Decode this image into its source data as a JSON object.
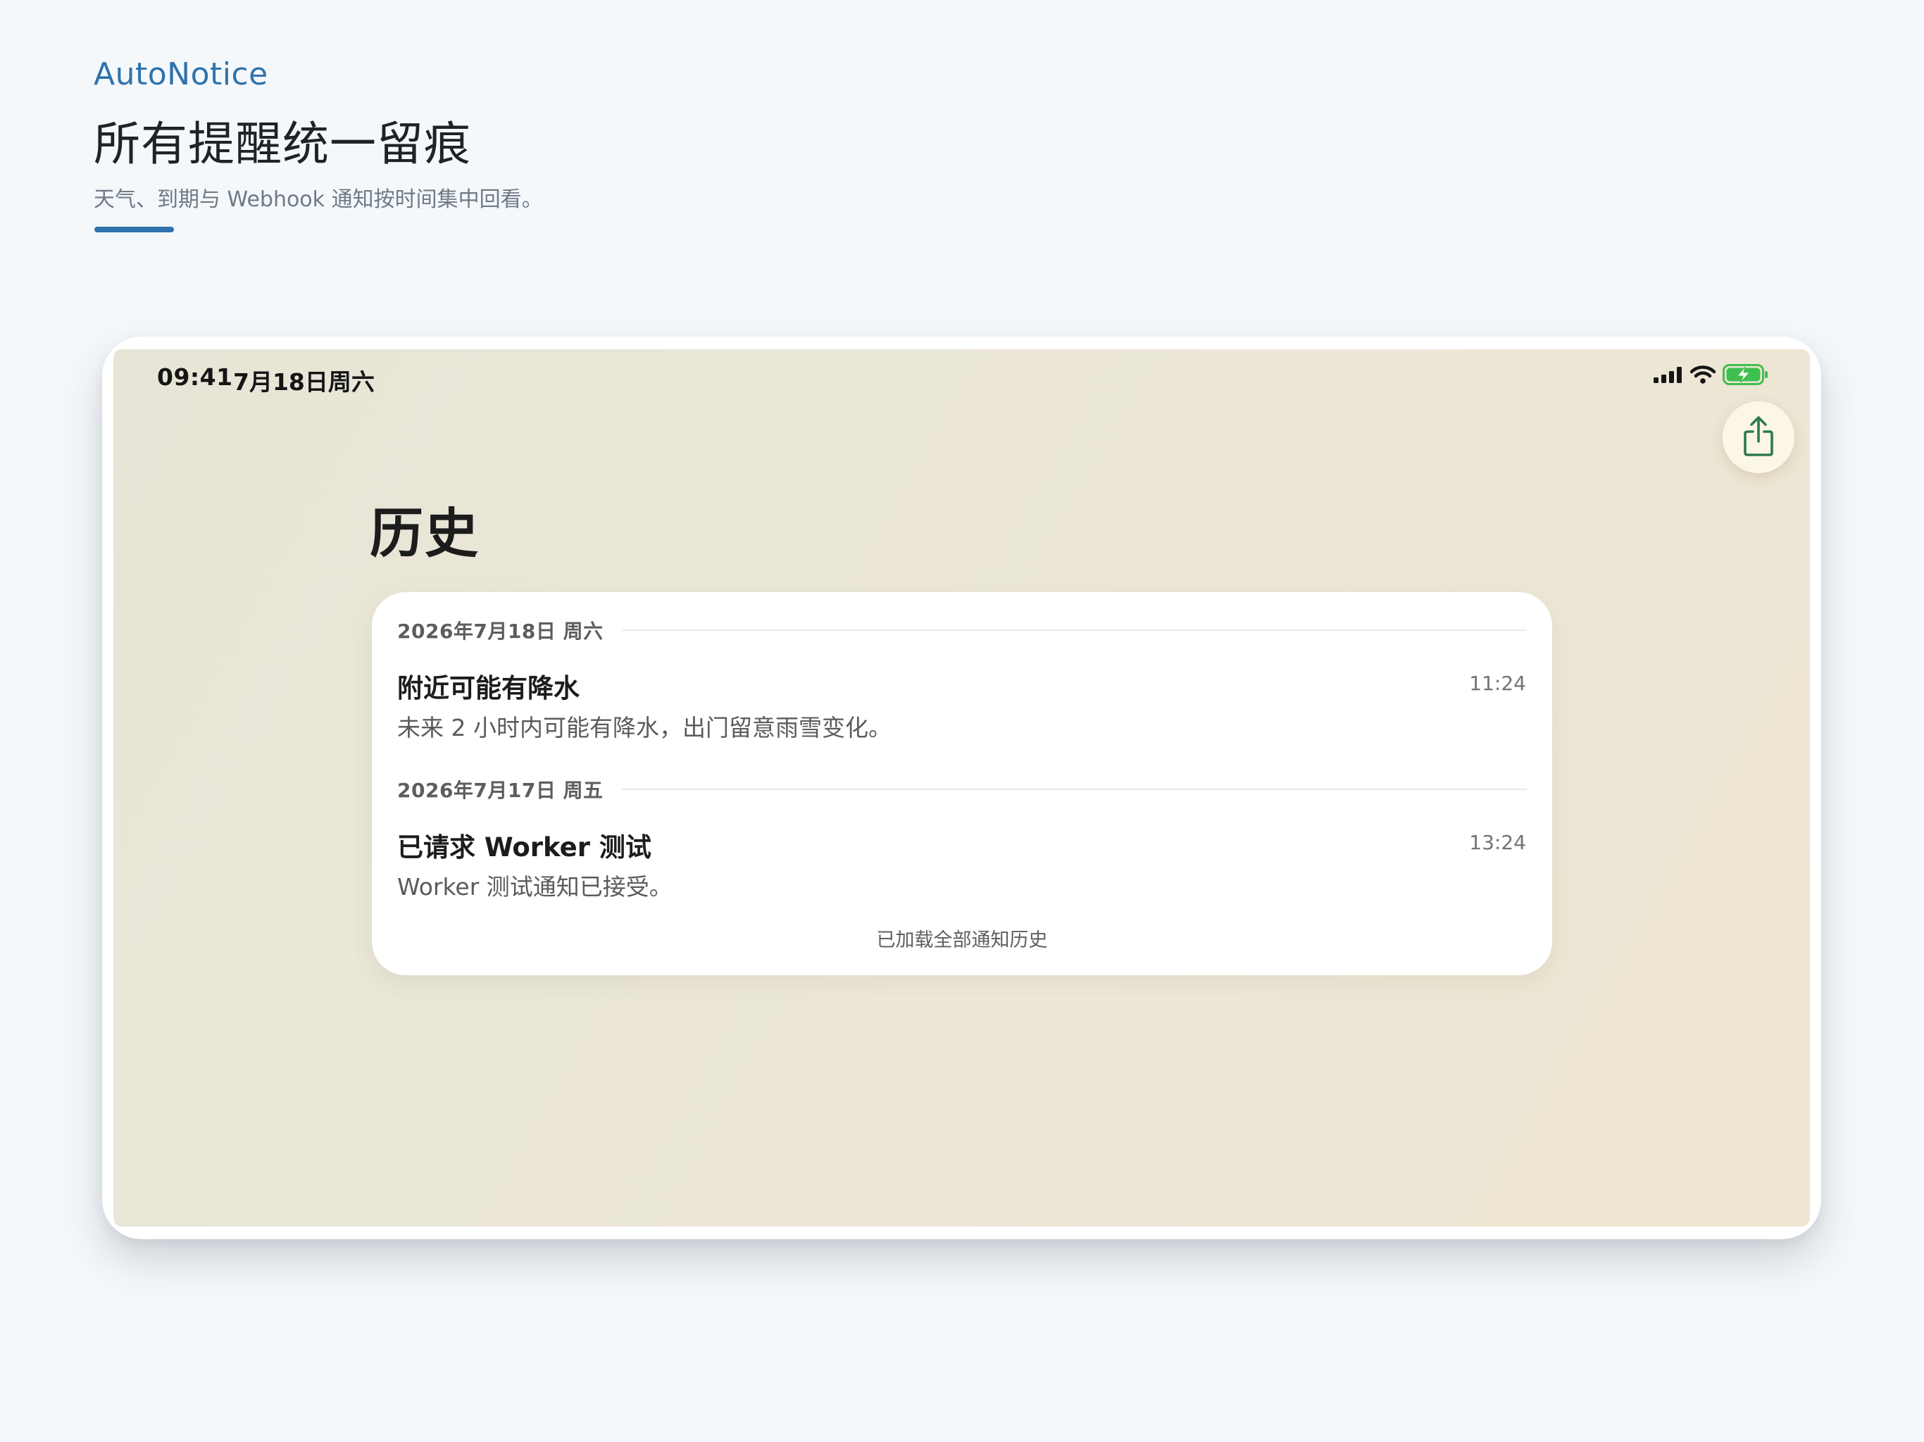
{
  "brand": "AutoNotice",
  "headline": "所有提醒统一留痕",
  "subline": "天气、到期与 Webhook 通知按时间集中回看。",
  "status_bar": {
    "time": "09:41",
    "date": "7月18日周六",
    "signal_icon": "cellular-signal-icon",
    "wifi_icon": "wifi-icon",
    "battery_icon": "battery-charging-icon"
  },
  "share_icon": "share-icon",
  "page_title": "历史",
  "history": {
    "days": [
      {
        "label": "2026年7月18日 周六",
        "items": [
          {
            "title": "附近可能有降水",
            "time": "11:24",
            "body": "未来 2 小时内可能有降水，出门留意雨雪变化。"
          }
        ]
      },
      {
        "label": "2026年7月17日 周五",
        "items": [
          {
            "title": "已请求 Worker 测试",
            "time": "13:24",
            "body": "Worker 测试通知已接受。"
          }
        ]
      }
    ],
    "footer": "已加载全部通知历史"
  },
  "colors": {
    "accent": "#2f72ad",
    "share_icon": "#2f7a48",
    "battery_fill": "#3fbf4f"
  }
}
